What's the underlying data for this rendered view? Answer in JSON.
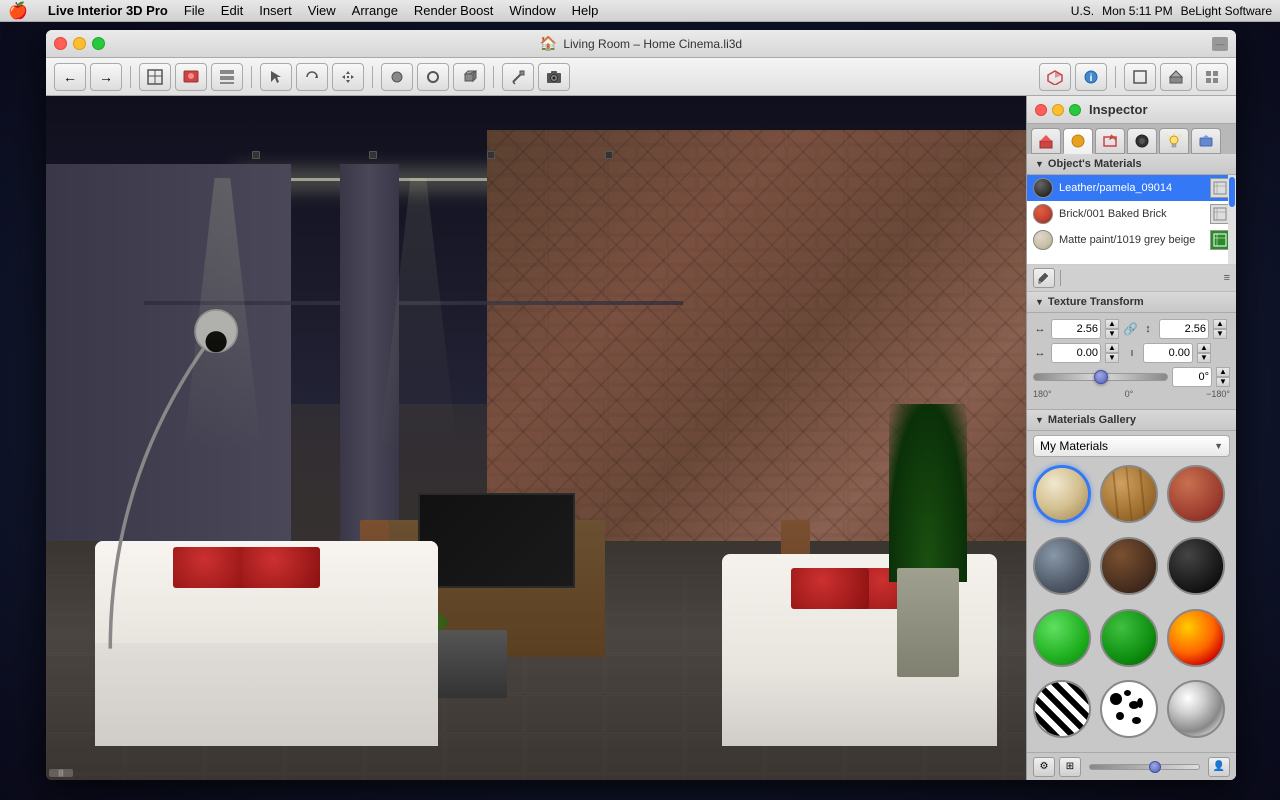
{
  "menubar": {
    "apple": "🍎",
    "app_name": "Live Interior 3D Pro",
    "menus": [
      "File",
      "Edit",
      "Insert",
      "View",
      "Arrange",
      "Render Boost",
      "Window",
      "Help"
    ],
    "right": {
      "time": "Mon 5:11 PM",
      "company": "BeLight Software",
      "locale": "U.S."
    }
  },
  "window": {
    "title": "Living Room – Home Cinema.li3d",
    "close_label": "×"
  },
  "inspector": {
    "title": "Inspector",
    "tabs": [
      "🏠",
      "🟡",
      "✏️",
      "⬛",
      "💡",
      "🏠"
    ],
    "materials_section": {
      "label": "Object's Materials",
      "items": [
        {
          "name": "Leather/pamela_09014",
          "swatch_color": "#444444",
          "selected": true
        },
        {
          "name": "Brick/001 Baked Brick",
          "swatch_color": "#cc4422"
        },
        {
          "name": "Matte paint/1019 grey beige",
          "swatch_color": "#c8b898"
        }
      ]
    },
    "texture_transform": {
      "label": "Texture Transform",
      "width_value": "2.56",
      "height_value": "2.56",
      "offset_x": "0.00",
      "offset_y": "0.00",
      "angle_value": "0°",
      "angle_min": "180°",
      "angle_zero": "0°",
      "angle_max": "−180°"
    },
    "gallery": {
      "label": "Materials Gallery",
      "dropdown_label": "My Materials",
      "items": [
        {
          "id": "mat-fabric",
          "type": "fabric",
          "selected": true
        },
        {
          "id": "mat-wood",
          "type": "wood"
        },
        {
          "id": "mat-brick",
          "type": "brick"
        },
        {
          "id": "mat-stone",
          "type": "stone"
        },
        {
          "id": "mat-darkwood",
          "type": "darkwood"
        },
        {
          "id": "mat-black",
          "type": "black"
        },
        {
          "id": "mat-green-bright",
          "type": "green-bright"
        },
        {
          "id": "mat-green-dark",
          "type": "green-dark"
        },
        {
          "id": "mat-fire",
          "type": "fire"
        },
        {
          "id": "mat-zebra",
          "type": "zebra"
        },
        {
          "id": "mat-dalmatian",
          "type": "dalmatian"
        },
        {
          "id": "mat-chrome",
          "type": "chrome"
        }
      ]
    }
  },
  "toolbar": {
    "nav_back": "←",
    "nav_fwd": "→",
    "btn_floorplan": "⊞",
    "btn_render": "🖼",
    "btn_layout": "▤",
    "tool_select": "↖",
    "tool_rotate": "↻",
    "tool_move": "⊕",
    "tool_sphere": "⬤",
    "tool_ring": "○",
    "tool_box": "□",
    "tool_build": "🔨",
    "tool_camera": "📷",
    "btn_3d": "🎯",
    "btn_info": "ℹ",
    "btn_square1": "□",
    "btn_house": "⌂",
    "btn_grid": "⊞"
  },
  "viewport": {
    "scroll_indicator": "|||"
  }
}
